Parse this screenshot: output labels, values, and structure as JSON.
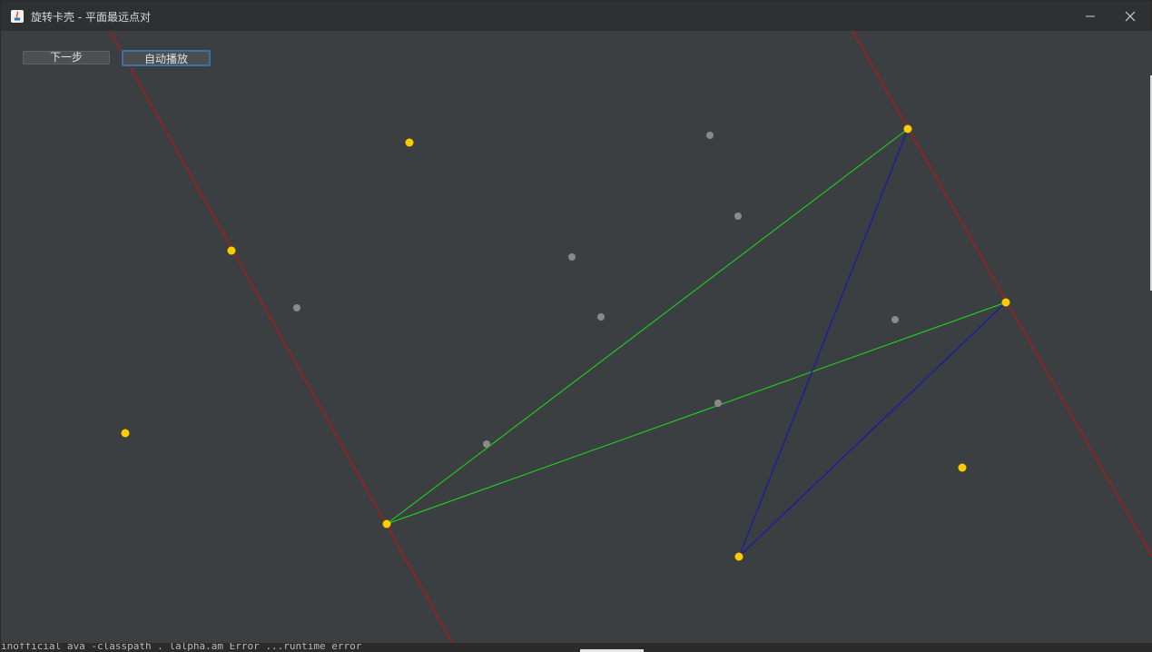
{
  "window": {
    "title": "旋转卡壳 - 平面最远点对"
  },
  "toolbar": {
    "next_label": "下一步",
    "autoplay_label": "自动播放"
  },
  "icons": {
    "app": "java-app-icon",
    "minimize": "minimize-icon",
    "close": "close-icon"
  },
  "colors": {
    "background": "#3c3f41",
    "hull_point": "#ffcc00",
    "inner_point": "#8a8a8a",
    "caliper_line": "#b01818",
    "candidate_segment": "#18e018",
    "current_pair_segment": "#1a1aa8"
  },
  "console_text": "inofficial ava -classpath . lalpha.am Error ...runtime error"
}
